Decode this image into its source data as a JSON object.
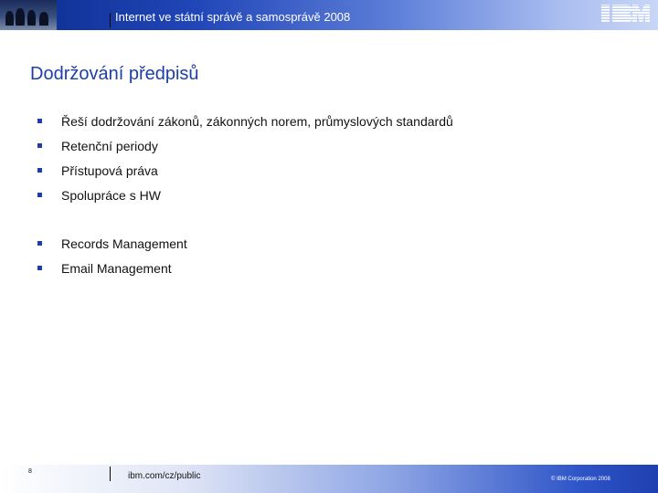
{
  "header": {
    "title": "Internet ve státní správě a samosprávě 2008",
    "logo": "IBM"
  },
  "slide": {
    "title": "Dodržování předpisů",
    "bullets": [
      "Řeší dodržování zákonů, zákonných norem, průmyslových standardů",
      "Retenční periody",
      "Přístupová práva",
      "Spolupráce s HW",
      "Records Management",
      "Email Management"
    ]
  },
  "footer": {
    "page_number": "8",
    "url": "ibm.com/cz/public",
    "copyright": "© IBM Corporation 2008"
  },
  "colors": {
    "accent": "#1c3fa8",
    "header_dark": "#0a2c8c",
    "footer_dark": "#1e3fb0"
  },
  "icons": [
    "square-bullet-icon",
    "ibm-logo"
  ]
}
